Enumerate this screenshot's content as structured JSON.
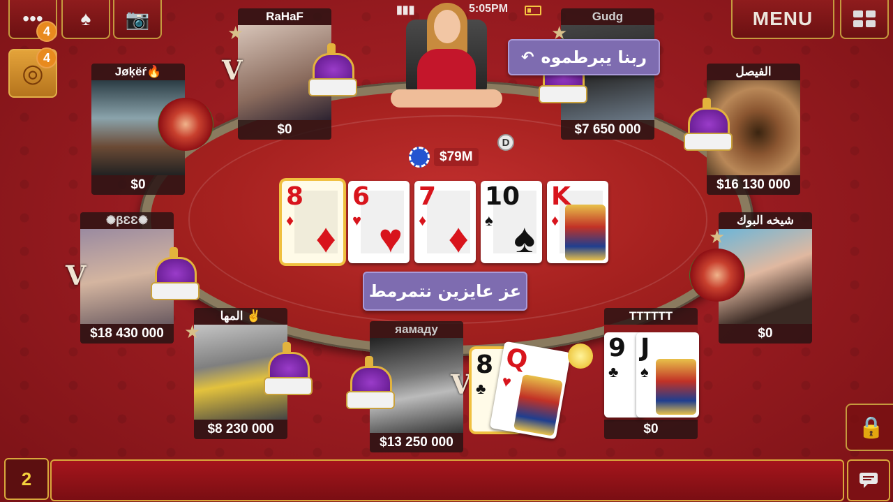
{
  "status_bar": {
    "time": "5:05PM"
  },
  "top_left": {
    "more_icon": "more-dots-icon",
    "badge_more": "4",
    "badge_target": "4"
  },
  "top_right": {
    "menu_label": "MENU"
  },
  "pot": {
    "amount": "$79M"
  },
  "dealer_button": "D",
  "community_cards": [
    {
      "rank": "8",
      "suit": "♦",
      "color": "red",
      "highlight": true
    },
    {
      "rank": "6",
      "suit": "♥",
      "color": "red",
      "highlight": false
    },
    {
      "rank": "7",
      "suit": "♦",
      "color": "red",
      "highlight": false
    },
    {
      "rank": "10",
      "suit": "♠",
      "color": "black",
      "highlight": false
    },
    {
      "rank": "K",
      "suit": "♦",
      "color": "red",
      "highlight": false
    }
  ],
  "players": {
    "rahaf": {
      "name": "RaHaF",
      "chips": "$0"
    },
    "gudg": {
      "name": "Gudg",
      "chips": "$7 650 000"
    },
    "joker": {
      "name": "Jøķëŕ🔥",
      "chips": "$0"
    },
    "faisal": {
      "name": "الفيصل",
      "chips": "$16 130 000"
    },
    "bee": {
      "name": "✺βƐƐ✺",
      "chips": "$18 430 000"
    },
    "sheikha": {
      "name": "شيخه البوك",
      "chips": "$0"
    },
    "maha": {
      "name": "المها ✌",
      "chips": "$8 230 000"
    },
    "hamadu": {
      "name": "яамаду",
      "chips": "$13 250 000"
    },
    "tttttt": {
      "name": "TTTTTT",
      "chips": "$0"
    }
  },
  "hole_cards": {
    "hamadu": [
      {
        "rank": "8",
        "suit": "♣"
      },
      {
        "rank": "Q",
        "suit": "♥"
      }
    ],
    "tttttt": [
      {
        "rank": "9",
        "suit": "♣"
      },
      {
        "rank": "J",
        "suit": "♠"
      }
    ]
  },
  "chat_bubbles": {
    "top": "ربنا يبرطموه",
    "center": "عز عايزين نتمرمط"
  },
  "bottom": {
    "counter": "2"
  }
}
